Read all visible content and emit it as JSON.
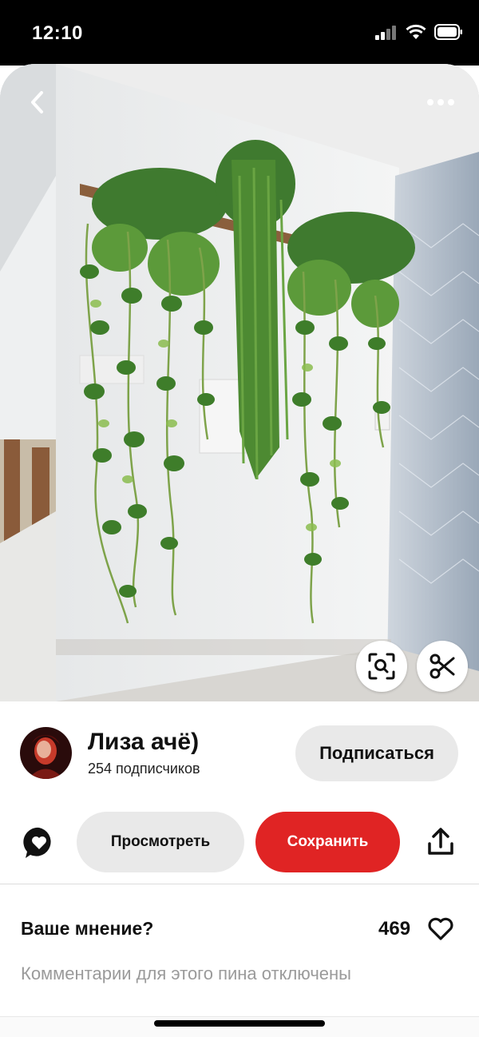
{
  "status_bar": {
    "time": "12:10"
  },
  "pin": {
    "back_icon": "chevron-left-icon",
    "more_icon": "more-horizontal-icon",
    "lens_icon": "visual-search-icon",
    "cut_icon": "scissors-icon"
  },
  "creator": {
    "name": "Лиза ачё)",
    "followers": "254 подписчиков",
    "follow_label": "Подписаться"
  },
  "actions": {
    "comment_icon": "heart-bubble-icon",
    "view_label": "Просмотреть",
    "save_label": "Сохранить",
    "share_icon": "share-icon"
  },
  "comments": {
    "title": "Ваше мнение?",
    "likes": "469",
    "like_icon": "heart-outline-icon",
    "disabled_note": "Комментарии для этого пина отключены"
  },
  "colors": {
    "save_red": "#e02424",
    "pill_gray": "#e9e9e9",
    "muted_text": "#9a9a9a"
  }
}
